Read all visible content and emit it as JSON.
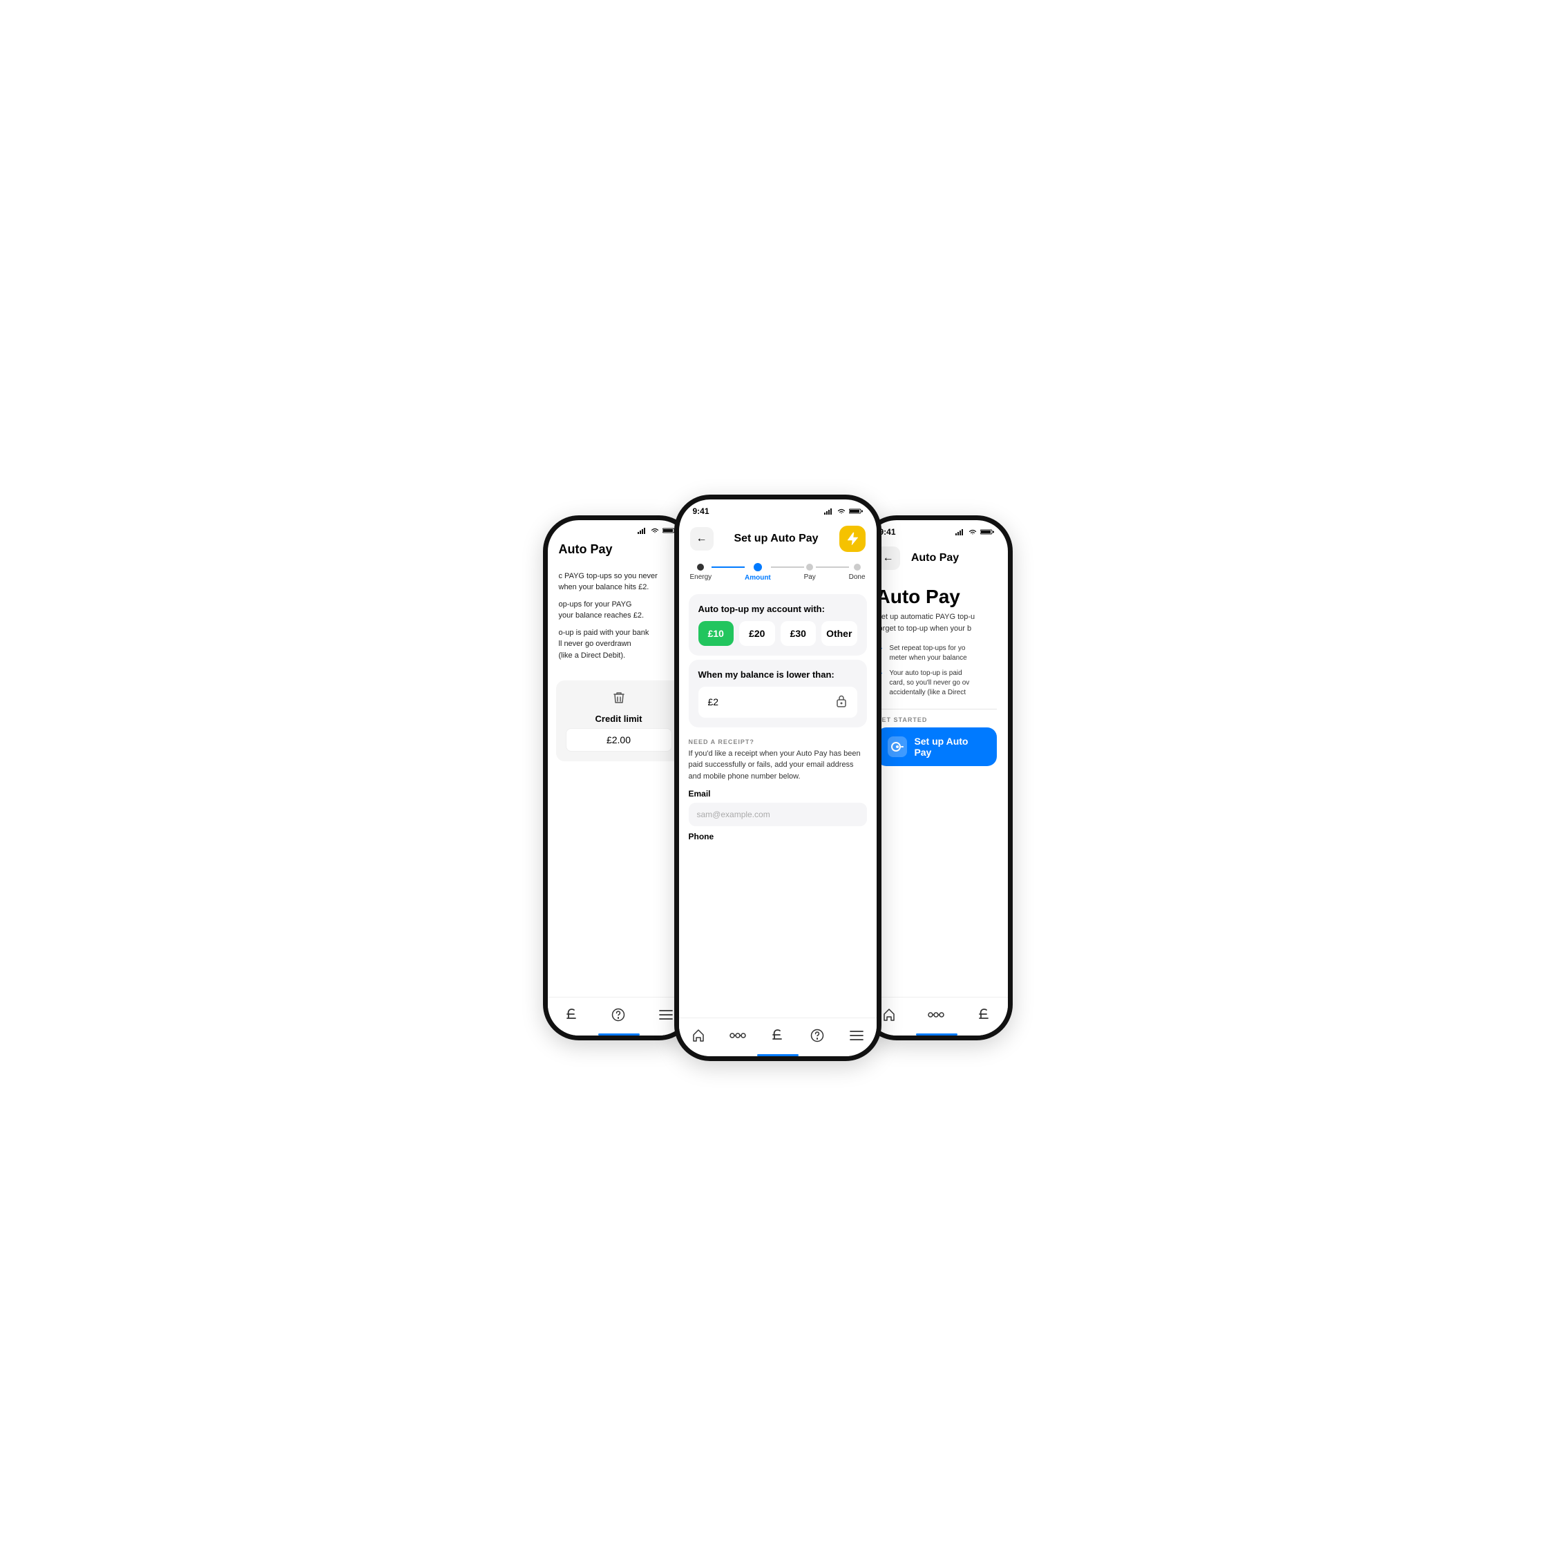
{
  "left_phone": {
    "title": "Auto Pay",
    "body_lines": [
      "c PAYG top-ups so you never",
      "when your balance hits £2.",
      "",
      "op-ups for your PAYG",
      "your balance reaches £2.",
      "o-up is paid with your bank",
      "ll never go overdrawn",
      "(like a Direct Debit)."
    ],
    "card": {
      "label": "Credit limit",
      "value": "£2.00"
    },
    "nav_items": [
      "£",
      "?",
      "≡"
    ]
  },
  "center_phone": {
    "time": "9:41",
    "header_title": "Set up Auto Pay",
    "back_icon": "←",
    "lightning_icon": "⚡",
    "stepper": [
      {
        "label": "Energy",
        "state": "done"
      },
      {
        "label": "Amount",
        "state": "active"
      },
      {
        "label": "Pay",
        "state": "inactive"
      },
      {
        "label": "Done",
        "state": "inactive"
      }
    ],
    "amount_card": {
      "title": "Auto top-up my account with:",
      "options": [
        {
          "value": "£10",
          "selected": true
        },
        {
          "value": "£20",
          "selected": false
        },
        {
          "value": "£30",
          "selected": false
        },
        {
          "value": "Other",
          "selected": false
        }
      ]
    },
    "balance_card": {
      "title": "When my balance is lower than:",
      "value": "£2"
    },
    "receipt_section": {
      "label": "NEED A RECEIPT?",
      "description": "If you'd like a receipt when your Auto Pay has been paid successfully or fails, add your email address and mobile phone number below.",
      "email_label": "Email",
      "email_placeholder": "sam@example.com",
      "phone_label": "Phone"
    },
    "nav_items": [
      "🏠",
      "∿",
      "£",
      "?",
      "≡"
    ]
  },
  "right_phone": {
    "time": "9:41",
    "header_title": "Auto Pay",
    "back_icon": "←",
    "hero_title": "Auto Pay",
    "description": "Set up automatic PAYG top-up forget to top-up when your b",
    "check_items": [
      "Set repeat top-ups for yo meter when your balance",
      "Your auto top-up is paid card, so you'll never go ov accidentally (like a Direct"
    ],
    "get_started_label": "GET STARTED",
    "setup_btn_label": "Set up Auto Pay",
    "nav_items": [
      "🏠",
      "∿",
      "£"
    ]
  },
  "colors": {
    "selected_amount": "#22C55E",
    "blue": "#007AFF",
    "yellow": "#F5C200",
    "light_bg": "#f5f5f7",
    "indicator": "#007AFF"
  }
}
